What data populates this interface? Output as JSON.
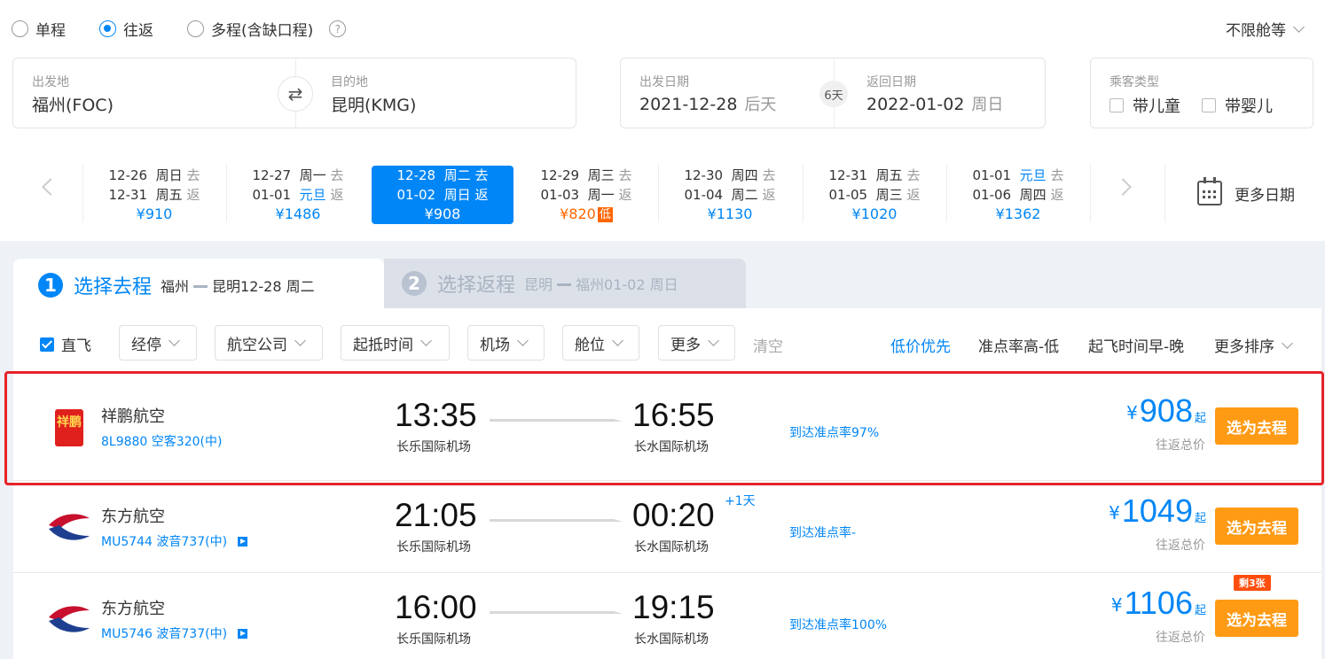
{
  "trip_types": [
    {
      "label": "单程",
      "selected": false
    },
    {
      "label": "往返",
      "selected": true
    },
    {
      "label": "多程(含缺口程)",
      "selected": false
    }
  ],
  "help_icon": "?",
  "cabin": "不限舱等",
  "route": {
    "from_label": "出发地",
    "from_value": "福州(FOC)",
    "to_label": "目的地",
    "to_value": "昆明(KMG)",
    "swap_icon": "⇄"
  },
  "dates": {
    "depart_label": "出发日期",
    "depart_value": "2021-12-28",
    "depart_sub": "后天",
    "return_label": "返回日期",
    "return_value": "2022-01-02",
    "return_sub": "周日",
    "days": "6天"
  },
  "passenger": {
    "label": "乘客类型",
    "child": "带儿童",
    "infant": "带婴儿"
  },
  "date_strip": [
    {
      "go_date": "12-26",
      "go_day": "周日",
      "go": "去",
      "back_date": "12-31",
      "back_day": "周五",
      "back": "返",
      "price": "¥910"
    },
    {
      "go_date": "12-27",
      "go_day": "周一",
      "go": "去",
      "back_date": "01-01",
      "back_day": "元旦",
      "back": "返",
      "price": "¥1486"
    },
    {
      "go_date": "12-28",
      "go_day": "周二",
      "go": "去",
      "back_date": "01-02",
      "back_day": "周日",
      "back": "返",
      "price": "¥908"
    },
    {
      "go_date": "12-29",
      "go_day": "周三",
      "go": "去",
      "back_date": "01-03",
      "back_day": "周一",
      "back": "返",
      "price": "¥820",
      "tag": "低"
    },
    {
      "go_date": "12-30",
      "go_day": "周四",
      "go": "去",
      "back_date": "01-04",
      "back_day": "周二",
      "back": "返",
      "price": "¥1130"
    },
    {
      "go_date": "12-31",
      "go_day": "周五",
      "go": "去",
      "back_date": "01-05",
      "back_day": "周三",
      "back": "返",
      "price": "¥1020"
    },
    {
      "go_date": "01-01",
      "go_day": "元旦",
      "go": "去",
      "back_date": "01-06",
      "back_day": "周四",
      "back": "返",
      "price": "¥1362"
    }
  ],
  "more_dates": "更多日期",
  "tabs": [
    {
      "num": "1",
      "title": "选择去程",
      "from": "福州",
      "to": "昆明",
      "date": "12-28 周二"
    },
    {
      "num": "2",
      "title": "选择返程",
      "from": "昆明",
      "to": "福州",
      "date": "01-02 周日"
    }
  ],
  "filters": {
    "direct": "直飞",
    "buttons": [
      "经停",
      "航空公司",
      "起抵时间",
      "机场",
      "舱位",
      "更多"
    ],
    "clear": "清空",
    "sorts": [
      "低价优先",
      "准点率高-低",
      "起飞时间早-晚",
      "更多排序"
    ]
  },
  "flights": [
    {
      "airline": "祥鹏航空",
      "flight_no": "8L9880 空客320(中)",
      "dep_time": "13:35",
      "dep_airport": "长乐国际机场",
      "arr_time": "16:55",
      "arr_airport": "长水国际机场",
      "plus_day": "",
      "ontime": "到达准点率97%",
      "yen": "¥",
      "price": "908",
      "qi": "起",
      "total": "往返总价",
      "button": "选为去程",
      "tag": ""
    },
    {
      "airline": "东方航空",
      "flight_no": "MU5744 波音737(中)",
      "dep_time": "21:05",
      "dep_airport": "长乐国际机场",
      "arr_time": "00:20",
      "arr_airport": "长水国际机场",
      "plus_day": "+1天",
      "ontime": "到达准点率-",
      "yen": "¥",
      "price": "1049",
      "qi": "起",
      "total": "往返总价",
      "button": "选为去程",
      "tag": ""
    },
    {
      "airline": "东方航空",
      "flight_no": "MU5746 波音737(中)",
      "dep_time": "16:00",
      "dep_airport": "长乐国际机场",
      "arr_time": "19:15",
      "arr_airport": "长水国际机场",
      "plus_day": "",
      "ontime": "到达准点率100%",
      "yen": "¥",
      "price": "1106",
      "qi": "起",
      "total": "往返总价",
      "button": "选为去程",
      "tag": "剩3张"
    }
  ],
  "logo_text": {
    "xiangpeng": "祥鹏"
  },
  "colors": {
    "accent": "#0086f6",
    "orange": "#ff9a14",
    "low": "#ff6600",
    "highlight": "#e6232a"
  }
}
